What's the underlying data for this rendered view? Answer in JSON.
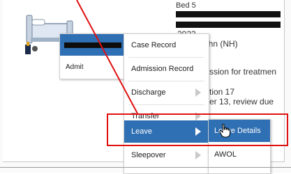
{
  "bed": {
    "title": "Bed 5",
    "year_fragment": "2023",
    "name_fragment": "ING, John (NH)",
    "admission_fragment": "ssion for treatmen",
    "ward_fragment": "tion 17",
    "review_fragment": "er 13, review due",
    "icon": "hospital-bed-icon"
  },
  "menu_level1": {
    "items": [
      "Admit"
    ]
  },
  "menu_level2": {
    "items": [
      {
        "label": "Case Record",
        "has_submenu": false
      },
      {
        "label": "Admission Record",
        "has_submenu": false
      },
      {
        "label": "Discharge",
        "has_submenu": true
      },
      {
        "label": "Transfer",
        "has_submenu": true
      },
      {
        "label": "Leave",
        "has_submenu": true,
        "active": true
      },
      {
        "label": "Sleepover",
        "has_submenu": true
      }
    ]
  },
  "menu_level3": {
    "items": [
      {
        "label": "Leave Details",
        "active": true
      },
      {
        "label": "AWOL",
        "active": false
      }
    ]
  },
  "colors": {
    "highlight": "#2f6fb3",
    "annotation": "#e01010"
  }
}
